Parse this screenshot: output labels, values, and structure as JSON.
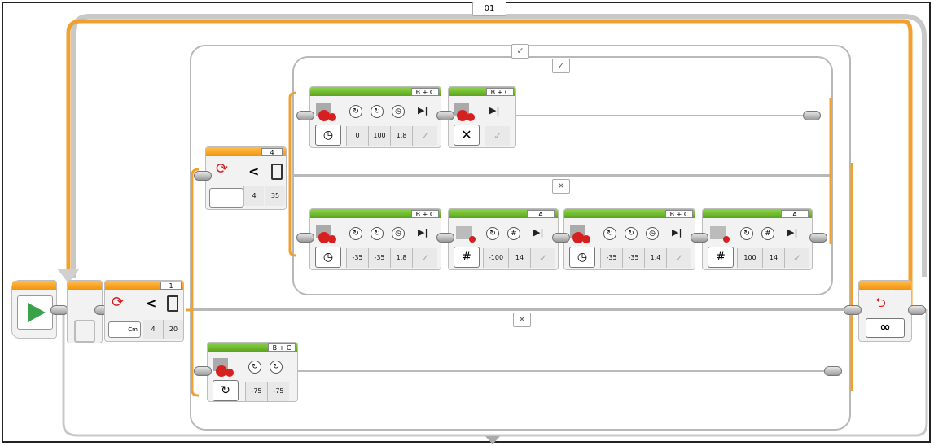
{
  "loop_top": {
    "label": "01",
    "mode_icon": "infinity-icon",
    "end_label": "∞"
  },
  "start_block": {
    "icon": "play-icon"
  },
  "switch_outer": {
    "number": "1",
    "compare": "<",
    "sensor_port_label": "Cm",
    "params": [
      "4",
      "20"
    ],
    "case_true": "✓",
    "case_false": "✕"
  },
  "switch_inner": {
    "number": "4",
    "compare": "<",
    "params": [
      "4",
      "35"
    ],
    "case_true": "✓",
    "case_false": "✕"
  },
  "blocks": {
    "tank_1": {
      "port": "B + C",
      "params": [
        "0",
        "100",
        "1.8"
      ]
    },
    "tank_stop": {
      "port": "B + C"
    },
    "tank_2": {
      "port": "B + C",
      "params": [
        "-35",
        "-35",
        "1.8"
      ]
    },
    "medium_1": {
      "port": "A",
      "params": [
        "-100",
        "14"
      ]
    },
    "tank_3": {
      "port": "B + C",
      "params": [
        "-35",
        "-35",
        "1.4"
      ]
    },
    "medium_2": {
      "port": "A",
      "params": [
        "100",
        "14"
      ]
    },
    "tank_4": {
      "port": "B + C",
      "params": [
        "-75",
        "-75"
      ]
    }
  },
  "colors": {
    "loop_orange": "#f0a030",
    "motor_green": "#6cbf2a",
    "switch_orange": "#f29310",
    "frame_grey": "#c8c8c8"
  }
}
